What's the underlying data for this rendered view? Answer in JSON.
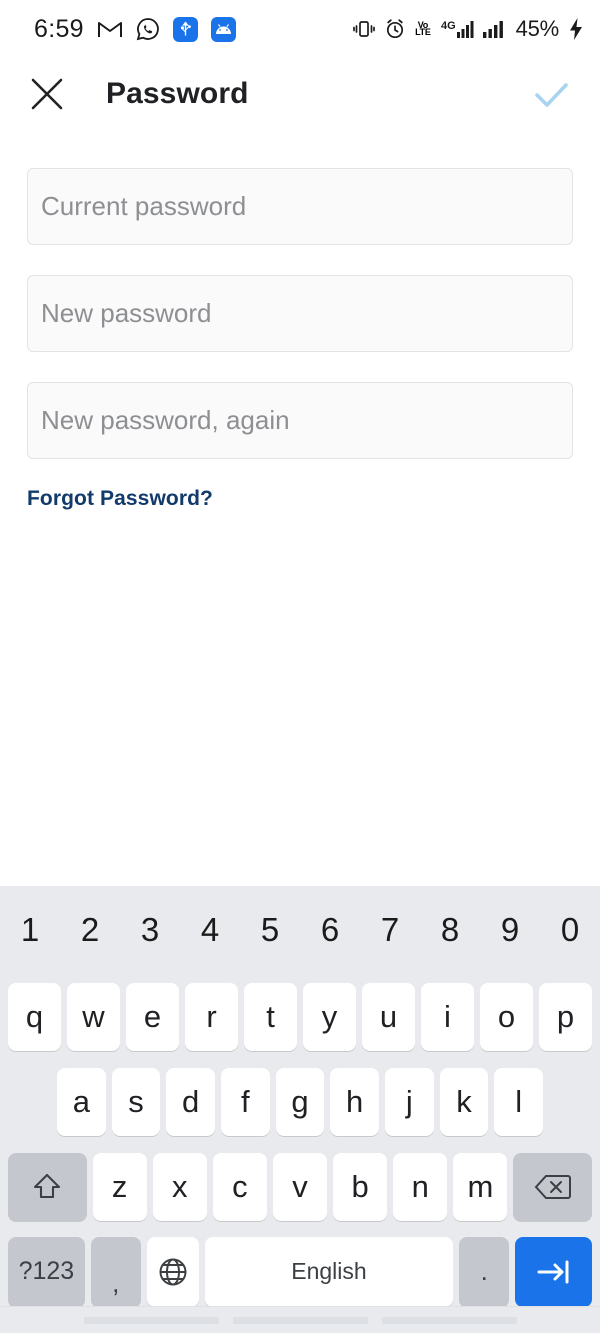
{
  "status_bar": {
    "time": "6:59",
    "left_icons": [
      {
        "name": "gmail-icon",
        "label": "M"
      },
      {
        "name": "whatsapp-icon",
        "label": "WhatsApp"
      },
      {
        "name": "usb-icon",
        "label": "USB"
      },
      {
        "name": "android-message-icon",
        "label": "Android"
      }
    ],
    "right_icons": [
      {
        "name": "vibrate-icon",
        "label": "Vibrate"
      },
      {
        "name": "alarm-icon",
        "label": "Alarm"
      },
      {
        "name": "volte-icon",
        "label": "VoLTE"
      },
      {
        "name": "signal-4g-icon",
        "label": "4G"
      },
      {
        "name": "signal-bars-icon",
        "label": "Signal"
      }
    ],
    "volte_top": "Vo",
    "volte_bottom": "LTE",
    "network_type": "4G",
    "battery_percent": "45%",
    "charging": true
  },
  "app_bar": {
    "close_label": "Close",
    "title": "Password",
    "confirm_label": "Confirm",
    "confirm_color": "#a8d4f0",
    "confirm_enabled": false
  },
  "form": {
    "fields": [
      {
        "name": "current-password-input",
        "placeholder": "Current password",
        "value": ""
      },
      {
        "name": "new-password-input",
        "placeholder": "New password",
        "value": ""
      },
      {
        "name": "confirm-password-input",
        "placeholder": "New password, again",
        "value": ""
      }
    ],
    "forgot_password_label": "Forgot Password?",
    "forgot_password_color": "#123a6b"
  },
  "keyboard": {
    "language": "English",
    "number_row": [
      "1",
      "2",
      "3",
      "4",
      "5",
      "6",
      "7",
      "8",
      "9",
      "0"
    ],
    "row1": [
      "q",
      "w",
      "e",
      "r",
      "t",
      "y",
      "u",
      "i",
      "o",
      "p"
    ],
    "row2": [
      "a",
      "s",
      "d",
      "f",
      "g",
      "h",
      "j",
      "k",
      "l"
    ],
    "row3": [
      "z",
      "x",
      "c",
      "v",
      "b",
      "n",
      "m"
    ],
    "shift_label": "Shift",
    "backspace_label": "Backspace",
    "symbols_label": "?123",
    "comma_label": ",",
    "globe_label": "Language",
    "space_label": "English",
    "period_label": ".",
    "enter_label": "Next",
    "enter_color": "#1a73e8",
    "background_color": "#e8eaed",
    "key_color": "#ffffff",
    "function_key_color": "#c4c7ce"
  },
  "nav_bar": {
    "segments": [
      "back",
      "home",
      "recents"
    ]
  }
}
